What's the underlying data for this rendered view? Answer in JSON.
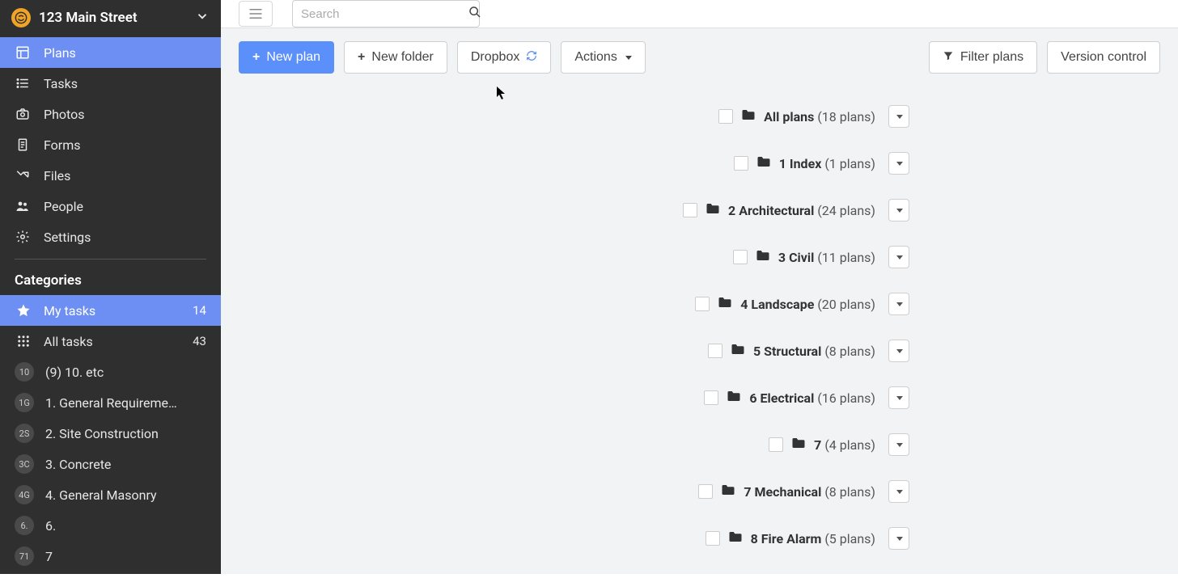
{
  "project": {
    "title": "123 Main Street"
  },
  "search": {
    "placeholder": "Search"
  },
  "nav": [
    {
      "key": "plans",
      "label": "Plans",
      "active": true
    },
    {
      "key": "tasks",
      "label": "Tasks",
      "active": false
    },
    {
      "key": "photos",
      "label": "Photos",
      "active": false
    },
    {
      "key": "forms",
      "label": "Forms",
      "active": false
    },
    {
      "key": "files",
      "label": "Files",
      "active": false
    },
    {
      "key": "people",
      "label": "People",
      "active": false
    },
    {
      "key": "settings",
      "label": "Settings",
      "active": false
    }
  ],
  "categories_header": "Categories",
  "categories": [
    {
      "key": "my-tasks",
      "label": "My tasks",
      "count": "14",
      "badge": null,
      "icon": "star",
      "active": true
    },
    {
      "key": "all-tasks",
      "label": "All tasks",
      "count": "43",
      "badge": null,
      "icon": "grid",
      "active": false
    },
    {
      "key": "c10",
      "label": "(9) 10. etc",
      "count": null,
      "badge": "10",
      "icon": null,
      "active": false
    },
    {
      "key": "c1g",
      "label": "1. General Requireme…",
      "count": null,
      "badge": "1G",
      "icon": null,
      "active": false
    },
    {
      "key": "c2s",
      "label": "2. Site Construction",
      "count": null,
      "badge": "2S",
      "icon": null,
      "active": false
    },
    {
      "key": "c3c",
      "label": "3. Concrete",
      "count": null,
      "badge": "3C",
      "icon": null,
      "active": false
    },
    {
      "key": "c4g",
      "label": "4. General Masonry",
      "count": null,
      "badge": "4G",
      "icon": null,
      "active": false
    },
    {
      "key": "c6",
      "label": "6.",
      "count": null,
      "badge": "6.",
      "icon": null,
      "active": false
    },
    {
      "key": "c71",
      "label": "7",
      "count": null,
      "badge": "71",
      "icon": null,
      "active": false
    }
  ],
  "toolbar": {
    "new_plan": "New plan",
    "new_folder": "New folder",
    "dropbox": "Dropbox",
    "actions": "Actions",
    "filter_plans": "Filter plans",
    "version_control": "Version control"
  },
  "folders": [
    {
      "name": "All plans",
      "count_text": "(18 plans)"
    },
    {
      "name": "1 Index",
      "count_text": "(1 plans)"
    },
    {
      "name": "2 Architectural",
      "count_text": "(24 plans)"
    },
    {
      "name": "3 Civil",
      "count_text": "(11 plans)"
    },
    {
      "name": "4 Landscape",
      "count_text": "(20 plans)"
    },
    {
      "name": "5 Structural",
      "count_text": "(8 plans)"
    },
    {
      "name": "6 Electrical",
      "count_text": "(16 plans)"
    },
    {
      "name": "7",
      "count_text": "(4 plans)"
    },
    {
      "name": "7 Mechanical",
      "count_text": "(8 plans)"
    },
    {
      "name": "8 Fire Alarm",
      "count_text": "(5 plans)"
    }
  ]
}
